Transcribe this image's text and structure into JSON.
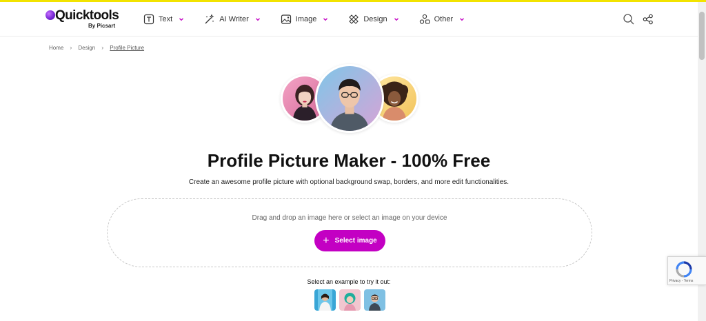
{
  "brand": {
    "name": "Quicktools",
    "sub": "By Picsart",
    "accent": "#c300c3",
    "top_strip": "#f2e300"
  },
  "nav": {
    "items": [
      {
        "label": "Text",
        "icon": "text-box-icon"
      },
      {
        "label": "AI Writer",
        "icon": "magic-wand-icon"
      },
      {
        "label": "Image",
        "icon": "image-icon"
      },
      {
        "label": "Design",
        "icon": "design-tools-icon"
      },
      {
        "label": "Other",
        "icon": "shapes-icon"
      }
    ],
    "search_icon": "search-icon",
    "share_icon": "share-icon"
  },
  "breadcrumb": {
    "home": "Home",
    "section": "Design",
    "current": "Profile Picture"
  },
  "hero": {
    "title_main": "Profile Picture Maker",
    "title_bold": " - 100% Free",
    "subtitle": "Create an awesome profile picture with optional background swap, borders, and more edit functionalities."
  },
  "upload": {
    "instruction": "Drag and drop an image here or select an image on your device",
    "button_label": "Select image"
  },
  "examples": {
    "label": "Select an example to try it out:",
    "count": 3
  },
  "recaptcha": {
    "text": "Privacy - Terms"
  }
}
